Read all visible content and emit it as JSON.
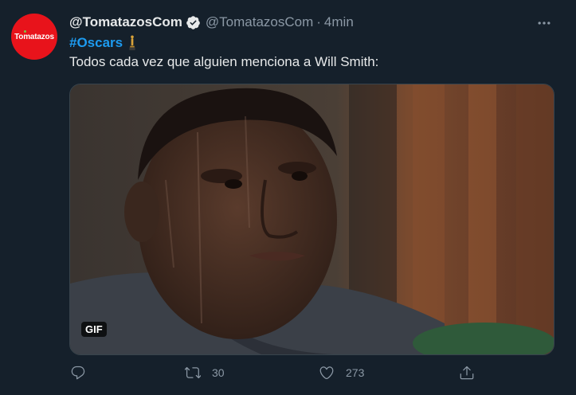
{
  "tweet": {
    "avatar_text": "Tomatazos",
    "display_name": "@TomatazosCom",
    "handle": "@TomatazosCom",
    "separator": "·",
    "time": "4min",
    "hashtag": "#Oscars",
    "text": "Todos cada vez que alguien menciona a Will Smith:",
    "media_badge": "GIF"
  },
  "actions": {
    "retweets": "30",
    "likes": "273"
  },
  "colors": {
    "background": "#15202b",
    "accent": "#1d9bf0",
    "secondary_text": "#8b98a5",
    "avatar": "#e8131b"
  },
  "icons": [
    "verified-icon",
    "more-icon",
    "trophy-icon",
    "reply-icon",
    "retweet-icon",
    "like-icon",
    "share-icon"
  ]
}
